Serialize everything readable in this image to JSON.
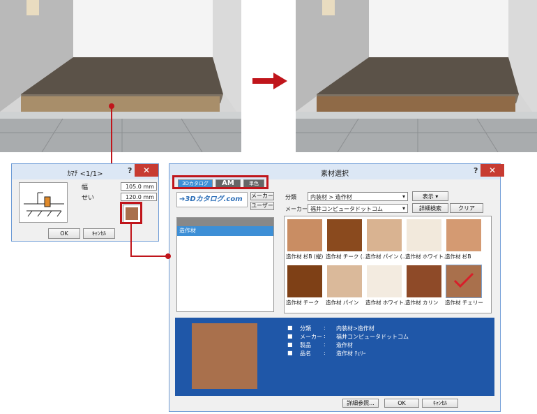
{
  "colors": {
    "accent": "#c0151b",
    "info_panel": "#1f57a8",
    "list_selected": "#3d8fd6",
    "title_bar": "#dce7f5",
    "close_button": "#c73b32"
  },
  "kamachi": {
    "title": "ｶﾏﾁ  <1/1>",
    "help": "?",
    "close": "✕",
    "width_label": "幅",
    "height_label": "せい",
    "width_value": "105.0 mm",
    "height_value": "120.0 mm",
    "ok": "OK",
    "cancel": "ｷｬﾝｾﾙ"
  },
  "material": {
    "title": "素材選択",
    "help": "?",
    "close": "✕",
    "tabs": [
      "3Dカタログ",
      "AM",
      "単色"
    ],
    "brand": "➔3Dカタログ.com",
    "maker_button": "メーカー",
    "user_button": "ユーザー",
    "category_label": "分類",
    "category_value": "内装材 > 造作材",
    "maker_label": "メーカー",
    "maker_value": "福井コンピュータドットコム",
    "display_button": "表示",
    "detail_search_button": "詳細検索",
    "clear_button": "クリア",
    "list_items": [
      "造作材"
    ],
    "swatches": [
      {
        "label": "造作材 杉B (縦)",
        "color": "#c98d63"
      },
      {
        "label": "造作材 チーク (…",
        "color": "#8a4a1e"
      },
      {
        "label": "造作材 パイン (…",
        "color": "#d9b391"
      },
      {
        "label": "造作材 ホワイト…",
        "color": "#f2e9dc"
      },
      {
        "label": "造作材 杉B",
        "color": "#d49a72"
      },
      {
        "label": "造作材 チーク",
        "color": "#7e4016"
      },
      {
        "label": "造作材 パイン",
        "color": "#dab99a"
      },
      {
        "label": "造作材 ホワイト…",
        "color": "#f3ebe0"
      },
      {
        "label": "造作材 カリン",
        "color": "#8e4a28"
      },
      {
        "label": "造作材 チェリー",
        "color": "#a9704c"
      }
    ],
    "info": {
      "keys": [
        "分類",
        "メーカー",
        "製品",
        "品名"
      ],
      "sep": ":",
      "values": [
        "内装材>造作材",
        "福井コンピュータドットコム",
        "造作材",
        "造作材 ﾁｪﾘｰ"
      ]
    },
    "detail_button": "詳細参照...",
    "ok": "OK",
    "cancel": "ｷｬﾝｾﾙ"
  }
}
